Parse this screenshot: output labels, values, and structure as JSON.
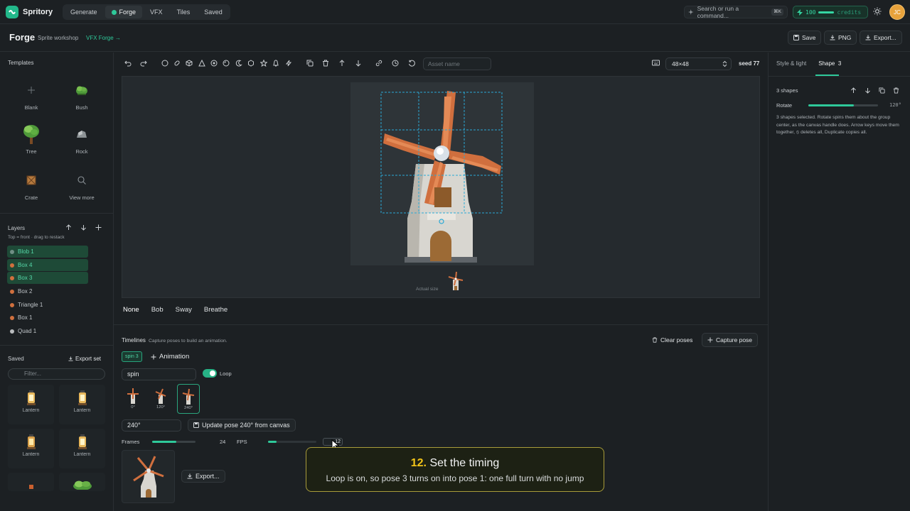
{
  "app": {
    "name": "Spritory"
  },
  "nav": {
    "tabs": [
      "Generate",
      "Forge",
      "VFX",
      "Tiles",
      "Saved"
    ],
    "active": "Forge"
  },
  "search": {
    "placeholder": "Search or run a command...",
    "shortcut": "⌘K"
  },
  "credits": {
    "value": "100",
    "label": "credits",
    "level": 1.0
  },
  "user": {
    "initials": "JC"
  },
  "page": {
    "title": "Forge",
    "subtitle": "Sprite workshop",
    "link": "VFX Forge →"
  },
  "actions": {
    "save": "Save",
    "png": "PNG",
    "export": "Export..."
  },
  "templates": {
    "heading": "Templates",
    "items": [
      {
        "label": "Blank",
        "icon": "plus-icon"
      },
      {
        "label": "Bush",
        "icon": "bush-icon"
      },
      {
        "label": "Tree",
        "icon": "tree-icon"
      },
      {
        "label": "Rock",
        "icon": "rock-icon"
      },
      {
        "label": "Crate",
        "icon": "crate-icon"
      },
      {
        "label": "View more",
        "icon": "search-icon"
      }
    ]
  },
  "layers": {
    "heading": "Layers",
    "hint": "Top = front · drag to restack",
    "items": [
      {
        "name": "Blob 1",
        "color": "#6f8f85",
        "selected": true
      },
      {
        "name": "Box 4",
        "color": "#d0703e",
        "selected": true
      },
      {
        "name": "Box 3",
        "color": "#d0703e",
        "selected": true
      },
      {
        "name": "Box 2",
        "color": "#d0703e",
        "selected": false
      },
      {
        "name": "Triangle 1",
        "color": "#d0703e",
        "selected": false
      },
      {
        "name": "Box 1",
        "color": "#d0703e",
        "selected": false
      },
      {
        "name": "Quad 1",
        "color": "#b9bcbe",
        "selected": false
      }
    ]
  },
  "saved": {
    "heading": "Saved",
    "export_set": "Export set",
    "filter_placeholder": "Filter...",
    "items": [
      "Lantern",
      "Lantern",
      "Lantern",
      "Lantern"
    ]
  },
  "toolbar": {
    "asset_placeholder": "Asset name",
    "size": "48×48",
    "seed": "seed 77"
  },
  "canvas": {
    "actual_size_label": "Actual size"
  },
  "anim_presets": [
    "None",
    "Bob",
    "Sway",
    "Breathe"
  ],
  "timelines": {
    "heading": "Timelines",
    "hint": "Capture poses to build an animation.",
    "clear": "Clear poses",
    "capture": "Capture pose",
    "chip": "spin 3",
    "add_animation": "Animation",
    "name": "spin",
    "loop_label": "Loop",
    "loop_on": true,
    "poses": [
      {
        "label": "0°",
        "selected": false
      },
      {
        "label": "120°",
        "selected": false
      },
      {
        "label": "240°",
        "selected": true
      }
    ],
    "angle": "240°",
    "update": "Update pose 240° from canvas",
    "frames_label": "Frames",
    "frames_value": "24",
    "frames_level": 0.55,
    "fps_label": "FPS",
    "fps_value": "12",
    "fps_level": 0.18,
    "export": "Export..."
  },
  "tutorial": {
    "step": "12.",
    "title": "Set the timing",
    "body": "Loop is on, so pose 3 turns on into pose 1: one full turn with no jump"
  },
  "inspector": {
    "tabs": [
      "Style & light",
      "Shape"
    ],
    "shape_count": "3",
    "selection": "3 shapes",
    "rotate_label": "Rotate",
    "rotate_value": "120°",
    "rotate_level": 0.65,
    "description": "3 shapes selected. Rotate spins them about the group center, as the canvas handle does. Arrow keys move them together, ⦸ deletes all, Duplicate copies all."
  }
}
